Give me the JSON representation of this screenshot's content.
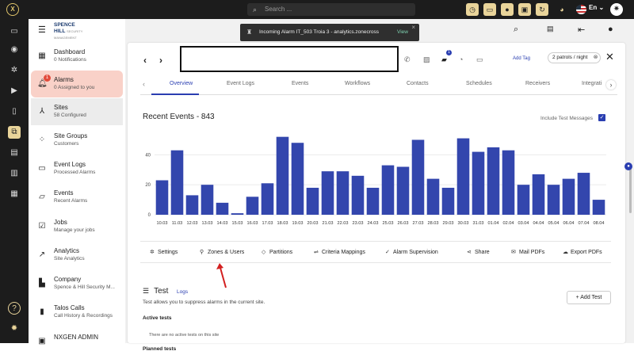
{
  "topbar": {
    "logo_text": "X",
    "search_placeholder": "Search ...",
    "language": "En",
    "icons": [
      "clock-icon",
      "monitor-icon",
      "person-icon",
      "lock-icon",
      "refresh-icon",
      "mask-icon"
    ]
  },
  "sidebar": {
    "brand_line1": "SPENCE",
    "brand_line2": "HILL",
    "brand_tag": "SECURITY MANAGEMENT",
    "items": [
      {
        "title": "Dashboard",
        "subtitle": "0 Notifications",
        "icon": "dashboard-icon"
      },
      {
        "title": "Alarms",
        "subtitle": "0 Assigned to you",
        "icon": "bell-icon",
        "badge": "1"
      },
      {
        "title": "Sites",
        "subtitle": "58 Configured",
        "icon": "sites-icon"
      },
      {
        "title": "Site Groups",
        "subtitle": "Customers",
        "icon": "groups-icon"
      },
      {
        "title": "Event Logs",
        "subtitle": "Processed Alarms",
        "icon": "folder-icon"
      },
      {
        "title": "Events",
        "subtitle": "Recent Alarms",
        "icon": "events-icon"
      },
      {
        "title": "Jobs",
        "subtitle": "Manage your jobs",
        "icon": "jobs-icon"
      },
      {
        "title": "Analytics",
        "subtitle": "Site Analytics",
        "icon": "analytics-icon"
      },
      {
        "title": "Company",
        "subtitle": "Spence & Hill Security M...",
        "icon": "company-icon"
      },
      {
        "title": "Talos Calls",
        "subtitle": "Call History & Recordings",
        "icon": "calls-icon"
      },
      {
        "title": "NXGEN ADMIN",
        "subtitle": "",
        "icon": "admin-icon"
      }
    ]
  },
  "toast": {
    "message": "Incoming Alarm IT_503 Troia 3 - analytics.zonecross",
    "action": "View"
  },
  "site_header": {
    "add_tag": "Add Tag",
    "patrol_chip": "2 patrols / night",
    "message_badge": "1"
  },
  "tabs": [
    "Overview",
    "Event Logs",
    "Events",
    "Workflows",
    "Contacts",
    "Schedules",
    "Receivers",
    "Integrati"
  ],
  "chart_title": "Recent Events - 843",
  "include_test_label": "Include Test Messages",
  "chart_data": {
    "type": "bar",
    "title": "Recent Events - 843",
    "categories": [
      "10.03",
      "11.03",
      "12.03",
      "13.03",
      "14.03",
      "15.03",
      "16.03",
      "17.03",
      "18.03",
      "19.03",
      "20.03",
      "21.03",
      "22.03",
      "23.03",
      "24.03",
      "25.03",
      "26.03",
      "27.03",
      "28.03",
      "29.03",
      "30.03",
      "31.03",
      "01.04",
      "02.04",
      "03.04",
      "04.04",
      "05.04",
      "06.04",
      "07.04",
      "08.04"
    ],
    "values": [
      23,
      43,
      13,
      20,
      8,
      1,
      12,
      21,
      52,
      48,
      18,
      29,
      29,
      26,
      18,
      33,
      32,
      50,
      24,
      18,
      51,
      42,
      45,
      43,
      20,
      27,
      20,
      24,
      28,
      10
    ],
    "yticks": [
      0,
      20,
      40
    ],
    "ylim": [
      0,
      55
    ],
    "color": "#3346ad",
    "grid": true
  },
  "actions": [
    {
      "label": "Settings",
      "icon": "gear-icon"
    },
    {
      "label": "Zones & Users",
      "icon": "pin-icon"
    },
    {
      "label": "Partitions",
      "icon": "diamond-icon"
    },
    {
      "label": "Criteria Mappings",
      "icon": "mapping-icon"
    },
    {
      "label": "Alarm Supervision",
      "icon": "check-circle-icon"
    },
    {
      "label": "Share",
      "icon": "share-icon"
    },
    {
      "label": "Mail PDFs",
      "icon": "mail-icon"
    },
    {
      "label": "Export PDFs",
      "icon": "cloud-icon"
    }
  ],
  "test_section": {
    "title": "Test",
    "logs_link": "Logs",
    "add_button": "+ Add Test",
    "description": "Test allows you to suppress alarms in the current site.",
    "active_heading": "Active tests",
    "no_active": "There are no active tests on this site",
    "planned_heading": "Planned tests"
  }
}
